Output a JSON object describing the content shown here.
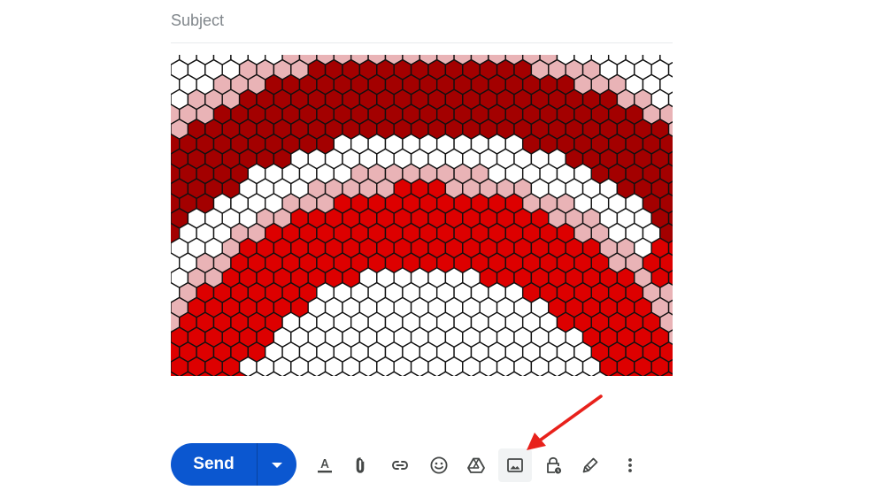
{
  "subject": {
    "placeholder": "Subject",
    "value": ""
  },
  "inline_image": {
    "palette": {
      "dark_red": "#a30000",
      "red": "#dd0000",
      "pink": "#e9b3b6",
      "white": "#ffffff",
      "outline": "#111111"
    }
  },
  "toolbar": {
    "send_label": "Send",
    "accent": "#0b57d0",
    "icons": [
      "text-format-icon",
      "attach-file-icon",
      "insert-link-icon",
      "insert-emoji-icon",
      "google-drive-icon",
      "insert-photo-icon",
      "confidential-mode-icon",
      "signature-pen-icon",
      "more-options-icon"
    ]
  },
  "annotation": {
    "arrow_color": "#e8211b"
  }
}
